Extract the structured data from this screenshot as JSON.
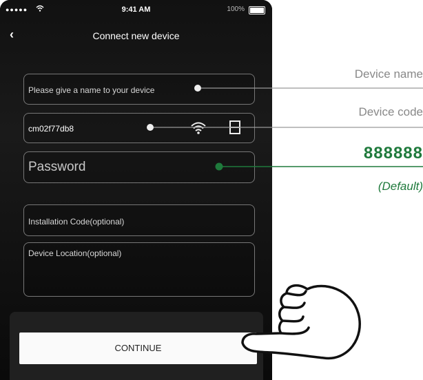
{
  "status_bar": {
    "signal": "●●●●●",
    "time": "9:41 AM",
    "battery": "100%"
  },
  "nav": {
    "back": "‹",
    "title": "Connect new device"
  },
  "form": {
    "device_name_placeholder": "Please give a name to your device",
    "device_code_value": "cm02f77db8",
    "password_placeholder": "Password",
    "installation_code_placeholder": "Installation Code(optional)",
    "device_location_placeholder": "Device Location(optional)"
  },
  "continue_label": "CONTINUE",
  "callouts": {
    "device_name": "Device name",
    "device_code": "Device code",
    "default_password": "888888",
    "default_note": "(Default)"
  },
  "colors": {
    "accent_green": "#1f7a3c",
    "callout_gray": "#888888",
    "phone_bg": "#0b0b0b"
  },
  "icons": [
    "back-chevron-icon",
    "wifi-icon",
    "qr-scan-icon",
    "pointing-hand-icon"
  ]
}
